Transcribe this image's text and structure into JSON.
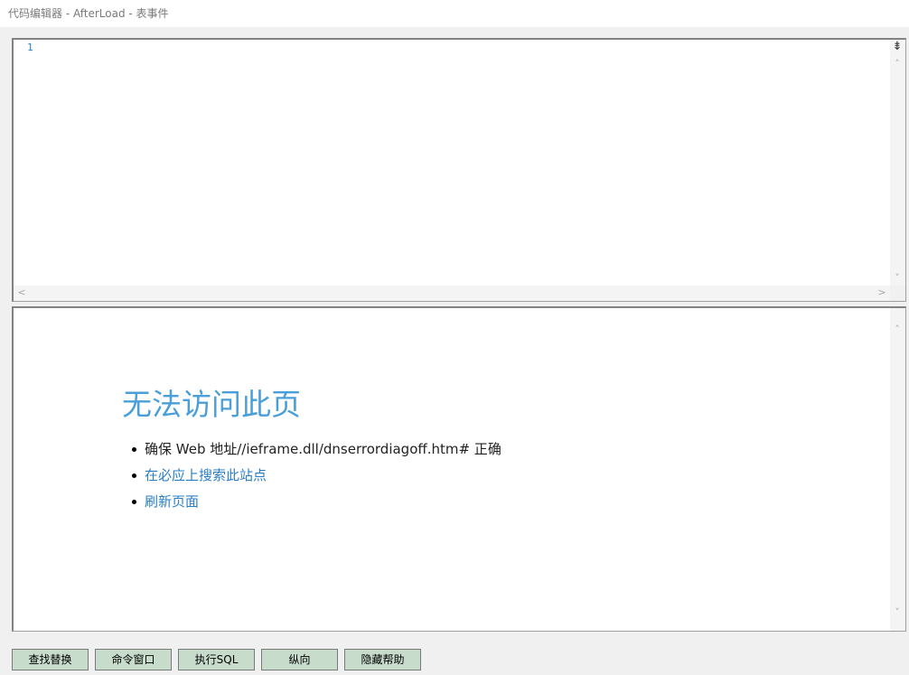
{
  "window": {
    "title": "代码编辑器 - AfterLoad - 表事件"
  },
  "editor": {
    "line_numbers": [
      "1"
    ],
    "split_icon": "split-pane-icon",
    "scroll_up": "˄",
    "scroll_down": "˅",
    "scroll_left": "<",
    "scroll_right": ">"
  },
  "help": {
    "title": "无法访问此页",
    "items": [
      {
        "text": "确保 Web 地址//ieframe.dll/dnserrordiagoff.htm# 正确",
        "link": false
      },
      {
        "text": "在必应上搜索此站点",
        "link": true
      },
      {
        "text": "刷新页面",
        "link": true
      }
    ],
    "scroll_up": "˄",
    "scroll_down": "˅"
  },
  "toolbar": {
    "buttons": [
      "查找替换",
      "命令窗口",
      "执行SQL",
      "纵向",
      "隐藏帮助"
    ]
  },
  "colors": {
    "title_blue": "#4a9fd8",
    "link_blue": "#2a7fc4",
    "button_bg": "#c8dccc"
  }
}
